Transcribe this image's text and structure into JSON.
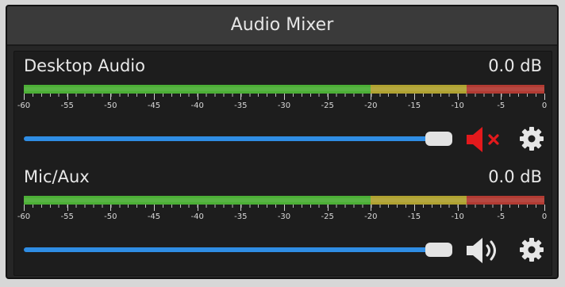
{
  "dock": {
    "title": "Audio Mixer"
  },
  "meter_scale": {
    "labels": [
      "-60",
      "-55",
      "-50",
      "-45",
      "-40",
      "-35",
      "-30",
      "-25",
      "-20",
      "-15",
      "-10",
      "-5",
      "0"
    ],
    "zones": [
      {
        "name": "nominal",
        "from_db": -60,
        "to_db": -20,
        "color": "#4caf36"
      },
      {
        "name": "warning",
        "from_db": -20,
        "to_db": -9,
        "color": "#b0a231"
      },
      {
        "name": "error",
        "from_db": -9,
        "to_db": 0,
        "color": "#b23b33"
      }
    ],
    "range_db": [
      -60,
      0
    ]
  },
  "channels": [
    {
      "name": "Desktop Audio",
      "level": "0.0 dB",
      "volume_fraction": 1.0,
      "muted": true,
      "mute_icon": "speaker-muted-icon",
      "mute_color": "#e3191c"
    },
    {
      "name": "Mic/Aux",
      "level": "0.0 dB",
      "volume_fraction": 1.0,
      "muted": false,
      "mute_icon": "speaker-icon",
      "mute_color": "#e6e6e6"
    }
  ],
  "colors": {
    "volume_fill": "#2f8de4",
    "handle": "#e3e3e3",
    "gear": "#e6e6e6"
  },
  "icons": {
    "settings": "gear-icon"
  }
}
